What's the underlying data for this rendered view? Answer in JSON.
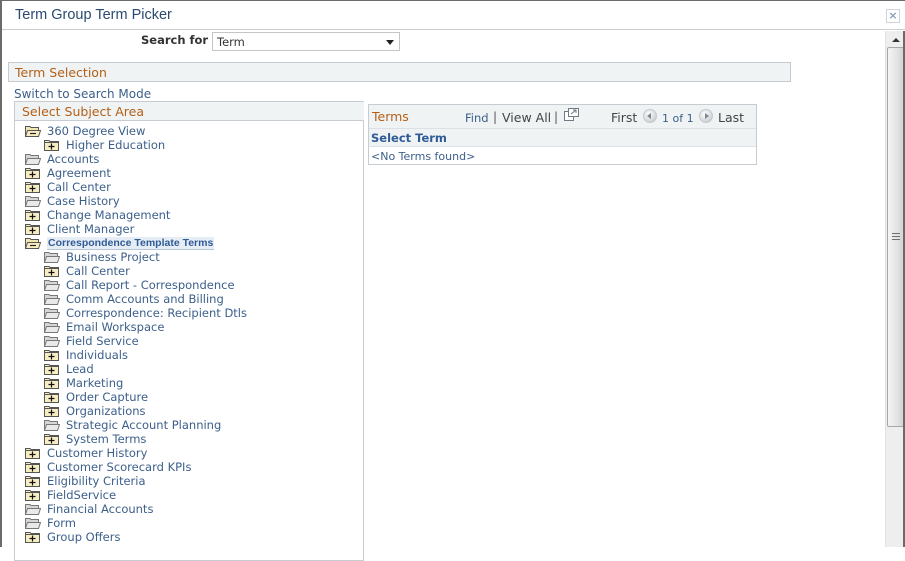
{
  "window": {
    "title": "Term Group Term Picker",
    "close_label": "×"
  },
  "search": {
    "label": "Search for",
    "selected": "Term"
  },
  "section": {
    "title": "Term Selection",
    "switch_link": "Switch to Search Mode"
  },
  "subject_area": {
    "title": "Select Subject Area",
    "items": [
      {
        "label": "360 Degree View",
        "level": 0,
        "icon": "folder-open-minus"
      },
      {
        "label": "Higher Education",
        "level": 1,
        "icon": "folder-plus"
      },
      {
        "label": "Accounts",
        "level": 0,
        "icon": "folder-leaf"
      },
      {
        "label": "Agreement",
        "level": 0,
        "icon": "folder-plus"
      },
      {
        "label": "Call Center",
        "level": 0,
        "icon": "folder-plus"
      },
      {
        "label": "Case History",
        "level": 0,
        "icon": "folder-leaf"
      },
      {
        "label": "Change Management",
        "level": 0,
        "icon": "folder-plus"
      },
      {
        "label": "Client Manager",
        "level": 0,
        "icon": "folder-plus"
      },
      {
        "label": "Correspondence Template Terms",
        "level": 0,
        "icon": "folder-open-minus",
        "selected": true
      },
      {
        "label": "Business Project",
        "level": 1,
        "icon": "folder-leaf"
      },
      {
        "label": "Call Center",
        "level": 1,
        "icon": "folder-plus"
      },
      {
        "label": "Call Report - Correspondence",
        "level": 1,
        "icon": "folder-leaf"
      },
      {
        "label": "Comm Accounts and Billing",
        "level": 1,
        "icon": "folder-leaf"
      },
      {
        "label": "Correspondence: Recipient Dtls",
        "level": 1,
        "icon": "folder-leaf"
      },
      {
        "label": "Email Workspace",
        "level": 1,
        "icon": "folder-leaf"
      },
      {
        "label": "Field Service",
        "level": 1,
        "icon": "folder-leaf"
      },
      {
        "label": "Individuals",
        "level": 1,
        "icon": "folder-plus"
      },
      {
        "label": "Lead",
        "level": 1,
        "icon": "folder-plus"
      },
      {
        "label": "Marketing",
        "level": 1,
        "icon": "folder-plus"
      },
      {
        "label": "Order Capture",
        "level": 1,
        "icon": "folder-plus"
      },
      {
        "label": "Organizations",
        "level": 1,
        "icon": "folder-plus"
      },
      {
        "label": "Strategic Account Planning",
        "level": 1,
        "icon": "folder-leaf"
      },
      {
        "label": "System Terms",
        "level": 1,
        "icon": "folder-plus"
      },
      {
        "label": "Customer History",
        "level": 0,
        "icon": "folder-plus"
      },
      {
        "label": "Customer Scorecard KPIs",
        "level": 0,
        "icon": "folder-plus"
      },
      {
        "label": "Eligibility Criteria",
        "level": 0,
        "icon": "folder-plus"
      },
      {
        "label": "FieldService",
        "level": 0,
        "icon": "folder-plus"
      },
      {
        "label": "Financial Accounts",
        "level": 0,
        "icon": "folder-leaf"
      },
      {
        "label": "Form",
        "level": 0,
        "icon": "folder-leaf"
      },
      {
        "label": "Group Offers",
        "level": 0,
        "icon": "folder-plus"
      }
    ]
  },
  "terms": {
    "title": "Terms",
    "find": "Find",
    "separator": "|",
    "view_all": "View All",
    "first": "First",
    "count": "1 of 1",
    "last": "Last",
    "column": "Select Term",
    "empty": "<No Terms found>"
  },
  "colors": {
    "link": "#3c5f8a",
    "section_title": "#b35f16",
    "header_bg": "#f0f3f4"
  }
}
